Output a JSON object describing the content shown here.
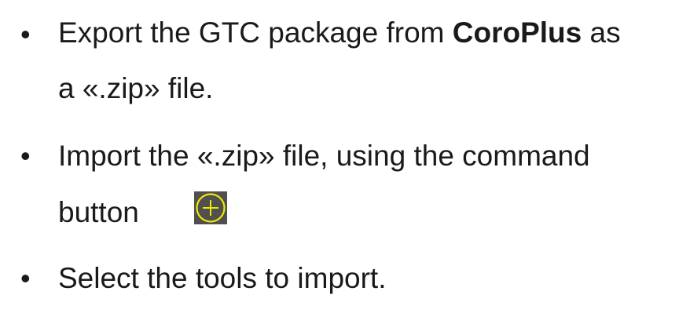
{
  "steps": [
    {
      "bullet": "•",
      "text_before": "Export the GTC package from ",
      "brand": "CoroPlus",
      "text_after": " as",
      "line2": "a «.zip» file."
    },
    {
      "bullet": "•",
      "line1": "Import the «.zip» file, using the command",
      "line2": "button"
    },
    {
      "bullet": "•",
      "line1": "Select the tools to import."
    }
  ],
  "command_icon": {
    "icon": "circle-plus-icon",
    "stroke_color": "#f2e600",
    "background_color": "#505050"
  }
}
